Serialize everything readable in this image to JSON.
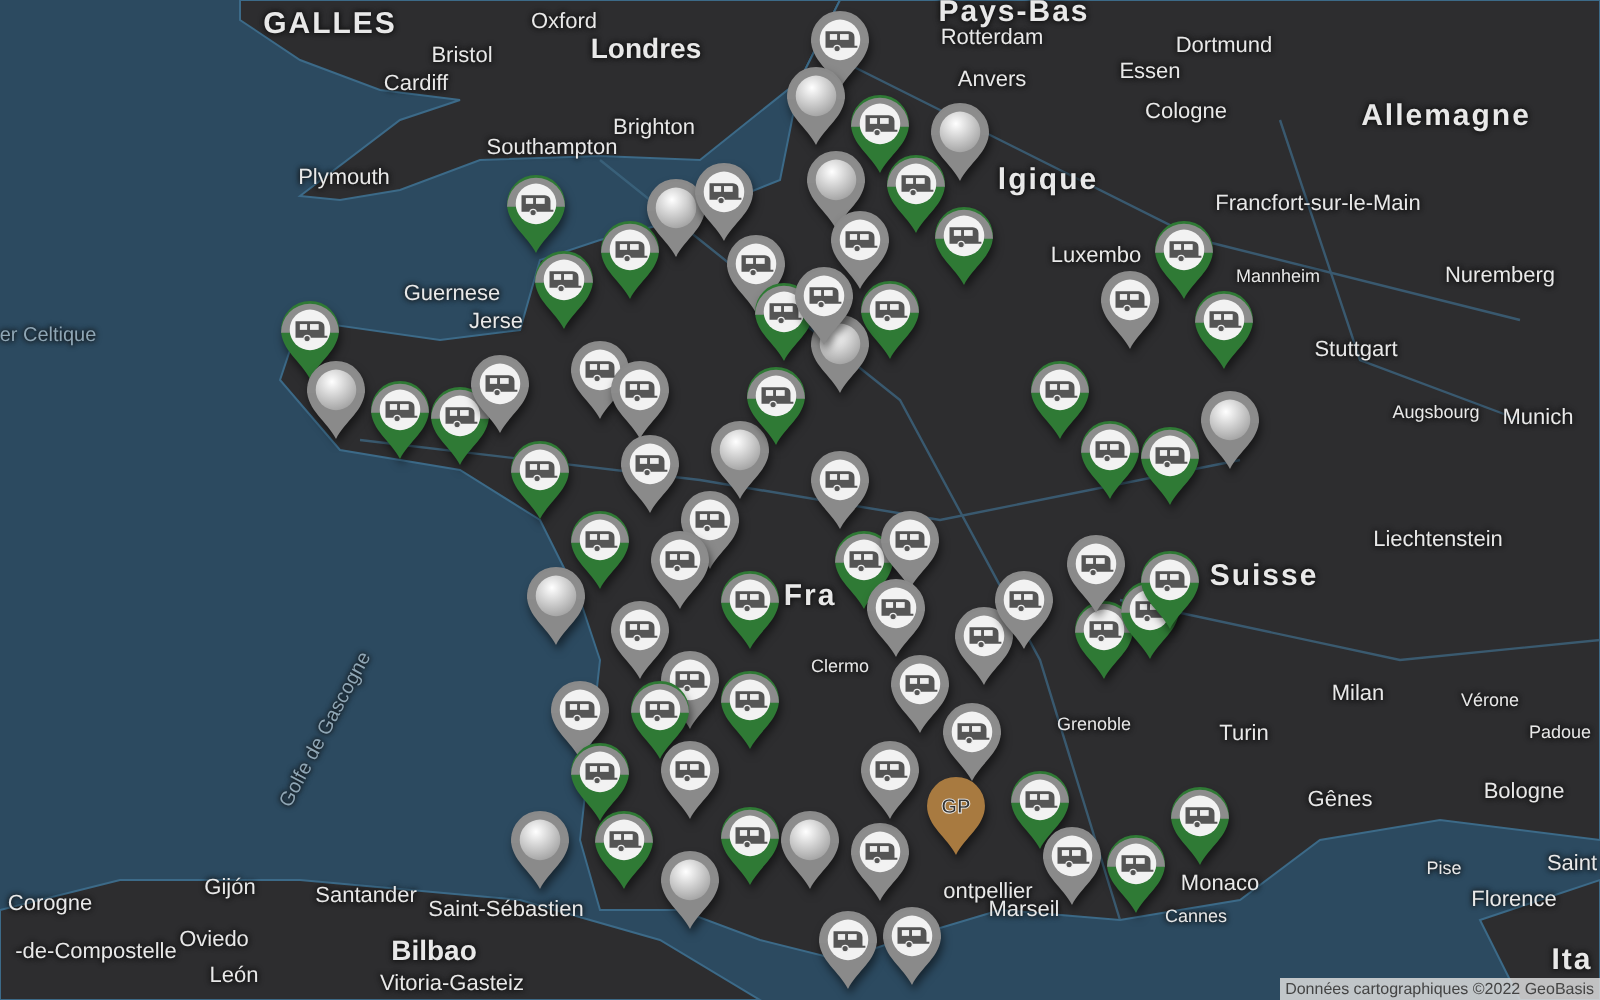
{
  "map": {
    "labels": [
      {
        "text": "GALLES",
        "kind": "country"
      },
      {
        "text": "Oxford",
        "kind": "city"
      },
      {
        "text": "Pays-Bas",
        "kind": "country"
      },
      {
        "text": "Bristol",
        "kind": "city"
      },
      {
        "text": "Londres",
        "kind": "major"
      },
      {
        "text": "Rotterdam",
        "kind": "city"
      },
      {
        "text": "Dortmund",
        "kind": "city"
      },
      {
        "text": "Cardiff",
        "kind": "city"
      },
      {
        "text": "Essen",
        "kind": "city"
      },
      {
        "text": "Anvers",
        "kind": "city"
      },
      {
        "text": "Southampton",
        "kind": "city"
      },
      {
        "text": "Brighton",
        "kind": "city"
      },
      {
        "text": "Cologne",
        "kind": "city"
      },
      {
        "text": "Allemagne",
        "kind": "country"
      },
      {
        "text": "Plymouth",
        "kind": "city"
      },
      {
        "text": "lgique",
        "kind": "country"
      },
      {
        "text": "Francfort-sur-le-Main",
        "kind": "city"
      },
      {
        "text": "Luxembo",
        "kind": "city"
      },
      {
        "text": "Guernese",
        "kind": "city"
      },
      {
        "text": "Mannheim",
        "kind": "small"
      },
      {
        "text": "Nuremberg",
        "kind": "city"
      },
      {
        "text": "er Celtique",
        "kind": "water"
      },
      {
        "text": "Jerse",
        "kind": "city"
      },
      {
        "text": "Stuttgart",
        "kind": "city"
      },
      {
        "text": "Augsbourg",
        "kind": "small"
      },
      {
        "text": "Munich",
        "kind": "city"
      },
      {
        "text": "Liechtenstein",
        "kind": "city"
      },
      {
        "text": "Suisse",
        "kind": "country"
      },
      {
        "text": "Fra",
        "kind": "country"
      },
      {
        "text": "Golfe de Gascogne",
        "kind": "gulf"
      },
      {
        "text": "Clermo",
        "kind": "small"
      },
      {
        "text": "Milan",
        "kind": "city"
      },
      {
        "text": "Vérone",
        "kind": "small"
      },
      {
        "text": "Grenoble",
        "kind": "small"
      },
      {
        "text": "Turin",
        "kind": "city"
      },
      {
        "text": "Padoue",
        "kind": "small"
      },
      {
        "text": "Gênes",
        "kind": "city"
      },
      {
        "text": "Bologne",
        "kind": "city"
      },
      {
        "text": "Corogne",
        "kind": "city"
      },
      {
        "text": "Gijón",
        "kind": "city"
      },
      {
        "text": "Santander",
        "kind": "city"
      },
      {
        "text": "Saint-Sébastien",
        "kind": "city"
      },
      {
        "text": "ontpellier",
        "kind": "city"
      },
      {
        "text": "Marseil",
        "kind": "city"
      },
      {
        "text": "Monaco",
        "kind": "city"
      },
      {
        "text": "Cannes",
        "kind": "small"
      },
      {
        "text": "Pise",
        "kind": "small"
      },
      {
        "text": "Florence",
        "kind": "city"
      },
      {
        "text": "Saint",
        "kind": "city"
      },
      {
        "text": "-de-Compostelle",
        "kind": "city"
      },
      {
        "text": "Oviedo",
        "kind": "city"
      },
      {
        "text": "Bilbao",
        "kind": "major"
      },
      {
        "text": "León",
        "kind": "city"
      },
      {
        "text": "Vitoria-Gasteiz",
        "kind": "city"
      },
      {
        "text": "Ita",
        "kind": "country"
      }
    ],
    "pins": [
      {
        "kind": "camper",
        "color": "#8a8a8a"
      },
      {
        "kind": "plain",
        "color": "#8a8a8a"
      },
      {
        "kind": "camper",
        "color": "#2f7a35"
      },
      {
        "kind": "plain",
        "color": "#8a8a8a"
      },
      {
        "kind": "camper",
        "color": "#2f7a35"
      },
      {
        "kind": "plain",
        "color": "#8a8a8a"
      },
      {
        "kind": "camper",
        "color": "#8a8a8a"
      },
      {
        "kind": "camper",
        "color": "#2f7a35"
      },
      {
        "kind": "camper",
        "color": "#2f7a35"
      },
      {
        "kind": "plain",
        "color": "#8a8a8a"
      },
      {
        "kind": "camper",
        "color": "#2f7a35"
      },
      {
        "kind": "camper",
        "color": "#2f7a35"
      },
      {
        "kind": "camper",
        "color": "#2f7a35"
      },
      {
        "kind": "plain",
        "color": "#8a8a8a"
      },
      {
        "kind": "camper",
        "color": "#8a8a8a"
      },
      {
        "kind": "camper",
        "color": "#8a8a8a"
      },
      {
        "kind": "camper",
        "color": "#2f7a35"
      },
      {
        "kind": "camper",
        "color": "#8a8a8a"
      },
      {
        "kind": "camper",
        "color": "#2f7a35"
      },
      {
        "kind": "plain",
        "color": "#8a8a8a"
      },
      {
        "kind": "camper",
        "color": "#2f7a35"
      },
      {
        "kind": "camper",
        "color": "#2f7a35"
      },
      {
        "kind": "camper",
        "color": "#8a8a8a"
      },
      {
        "kind": "camper",
        "color": "#8a8a8a"
      },
      {
        "kind": "camper",
        "color": "#8a8a8a"
      },
      {
        "kind": "camper",
        "color": "#2f7a35"
      },
      {
        "kind": "camper",
        "color": "#8a8a8a"
      },
      {
        "kind": "plain",
        "color": "#8a8a8a"
      },
      {
        "kind": "camper",
        "color": "#8a8a8a"
      },
      {
        "kind": "camper",
        "color": "#2f7a35"
      },
      {
        "kind": "plain",
        "color": "#8a8a8a"
      },
      {
        "kind": "camper",
        "color": "#8a8a8a"
      },
      {
        "kind": "camper",
        "color": "#2f7a35"
      },
      {
        "kind": "camper",
        "color": "#8a8a8a"
      },
      {
        "kind": "camper",
        "color": "#8a8a8a"
      },
      {
        "kind": "camper",
        "color": "#8a8a8a"
      },
      {
        "kind": "camper",
        "color": "#2f7a35"
      },
      {
        "kind": "camper",
        "color": "#2f7a35"
      },
      {
        "kind": "camper",
        "color": "#2f7a35"
      },
      {
        "kind": "camper",
        "color": "#8a8a8a"
      },
      {
        "kind": "plain",
        "color": "#8a8a8a"
      },
      {
        "kind": "camper",
        "color": "#2f7a35"
      },
      {
        "kind": "plain",
        "color": "#8a8a8a"
      },
      {
        "kind": "camper",
        "color": "#2f7a35"
      },
      {
        "kind": "plain",
        "color": "#8a8a8a"
      },
      {
        "kind": "camper",
        "color": "#8a8a8a"
      },
      {
        "kind": "camper",
        "color": "#8a8a8a"
      },
      {
        "kind": "camper",
        "color": "#2f7a35"
      },
      {
        "kind": "camper",
        "color": "#8a8a8a"
      },
      {
        "kind": "camper",
        "color": "#2f7a35"
      },
      {
        "kind": "camper",
        "color": "#8a8a8a"
      },
      {
        "kind": "camper",
        "color": "#8a8a8a"
      },
      {
        "kind": "camper",
        "color": "#8a8a8a"
      },
      {
        "kind": "camper",
        "color": "#8a8a8a"
      },
      {
        "kind": "camper",
        "color": "#8a8a8a"
      },
      {
        "kind": "camper",
        "color": "#8a8a8a"
      },
      {
        "kind": "camper",
        "color": "#2f7a35"
      },
      {
        "kind": "camper",
        "color": "#8a8a8a"
      },
      {
        "kind": "camper",
        "color": "#2f7a35"
      },
      {
        "kind": "camper",
        "color": "#2f7a35"
      },
      {
        "kind": "camper",
        "color": "#2f7a35"
      },
      {
        "kind": "camper",
        "color": "#2f7a35"
      },
      {
        "kind": "plain",
        "color": "#8a8a8a"
      },
      {
        "kind": "camper",
        "color": "#2f7a35"
      },
      {
        "kind": "camper",
        "color": "#2f7a35"
      },
      {
        "kind": "camper",
        "color": "#2f7a35"
      },
      {
        "kind": "camper",
        "color": "#8a8a8a"
      },
      {
        "kind": "camper",
        "color": "#8a8a8a"
      },
      {
        "kind": "logo",
        "color": "#a87a40",
        "text": "GP"
      },
      {
        "kind": "camper",
        "color": "#2f7a35"
      },
      {
        "kind": "camper",
        "color": "#8a8a8a"
      },
      {
        "kind": "camper",
        "color": "#2f7a35"
      },
      {
        "kind": "camper",
        "color": "#2f7a35"
      },
      {
        "kind": "camper",
        "color": "#8a8a8a"
      }
    ],
    "attribution": "Données cartographiques ©2022 GeoBasis"
  }
}
